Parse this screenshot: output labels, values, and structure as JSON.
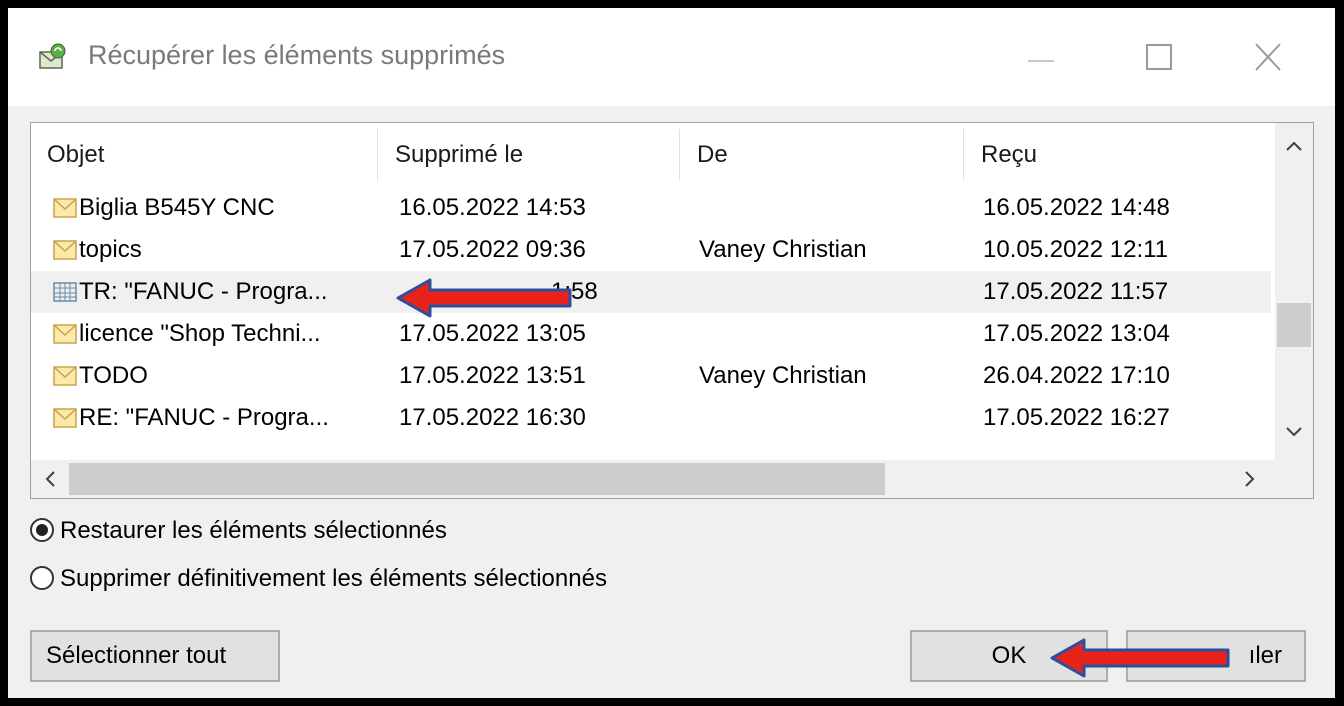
{
  "window": {
    "title": "Récupérer les éléments supprimés",
    "title_icon": "recycle-mail-icon"
  },
  "columns": [
    "Objet",
    "Supprimé le",
    "De",
    "Reçu"
  ],
  "rows": [
    {
      "subject": "Biglia B545Y CNC",
      "deleted": "16.05.2022 14:53",
      "from": "",
      "received": "16.05.2022 14:48",
      "icon": "envelope-icon"
    },
    {
      "subject": "topics",
      "deleted": "17.05.2022 09:36",
      "from": "Vaney Christian",
      "received": "10.05.2022 12:11",
      "icon": "envelope-icon"
    },
    {
      "subject": "TR: \"FANUC - Progra...",
      "deleted": "1:58",
      "from": "",
      "received": "17.05.2022 11:57",
      "icon": "calendar-icon",
      "highlighted": true
    },
    {
      "subject": "licence \"Shop Techni...",
      "deleted": "17.05.2022 13:05",
      "from": "",
      "received": "17.05.2022 13:04",
      "icon": "envelope-icon"
    },
    {
      "subject": "TODO",
      "deleted": "17.05.2022 13:51",
      "from": "Vaney Christian",
      "received": "26.04.2022 17:10",
      "icon": "envelope-icon"
    },
    {
      "subject": "RE: \"FANUC - Progra...",
      "deleted": "17.05.2022 16:30",
      "from": "",
      "received": "17.05.2022 16:27",
      "icon": "envelope-icon"
    }
  ],
  "options": {
    "restore_label": "Restaurer les éléments sélectionnés",
    "delete_label": "Supprimer définitivement les éléments sélectionnés",
    "selected": "restore"
  },
  "buttons": {
    "select_all": "Sélectionner tout",
    "ok": "OK",
    "cancel": "ıler"
  },
  "colors": {
    "annotation_arrow": "#e8231c",
    "annotation_outline": "#2b4f9e"
  }
}
